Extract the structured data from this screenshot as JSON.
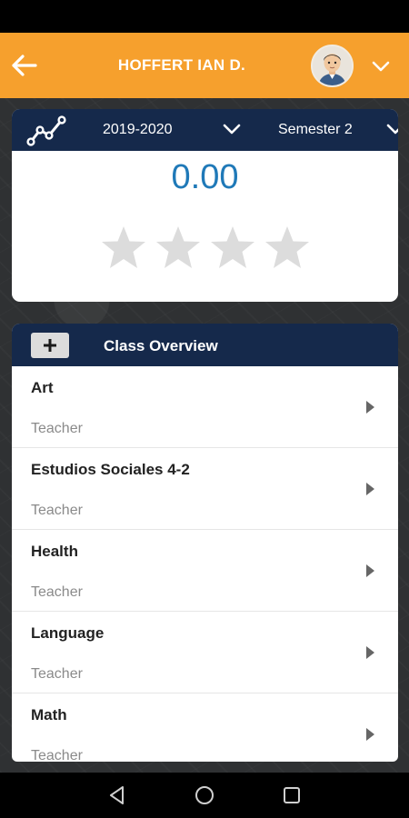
{
  "header": {
    "title": "HOFFERT IAN D.",
    "back_icon": "arrow-left-icon",
    "avatar": "student-avatar",
    "dropdown_icon": "chevron-down-icon",
    "accent_color": "#f6a02d"
  },
  "gpa_card": {
    "year": "2019-2020",
    "semester": "Semester 2",
    "gpa": "0.00",
    "stars_filled": 0,
    "stars_total": 4,
    "header_color": "#15294b"
  },
  "class_overview": {
    "title": "Class Overview",
    "add_icon": "plus-icon",
    "classes": [
      {
        "name": "Art",
        "role": "Teacher"
      },
      {
        "name": "Estudios Sociales 4-2",
        "role": "Teacher"
      },
      {
        "name": "Health",
        "role": "Teacher"
      },
      {
        "name": "Language",
        "role": "Teacher"
      },
      {
        "name": "Math",
        "role": "Teacher"
      }
    ]
  },
  "system_nav": {
    "back": "back-triangle-icon",
    "home": "home-circle-icon",
    "recents": "recents-square-icon"
  }
}
